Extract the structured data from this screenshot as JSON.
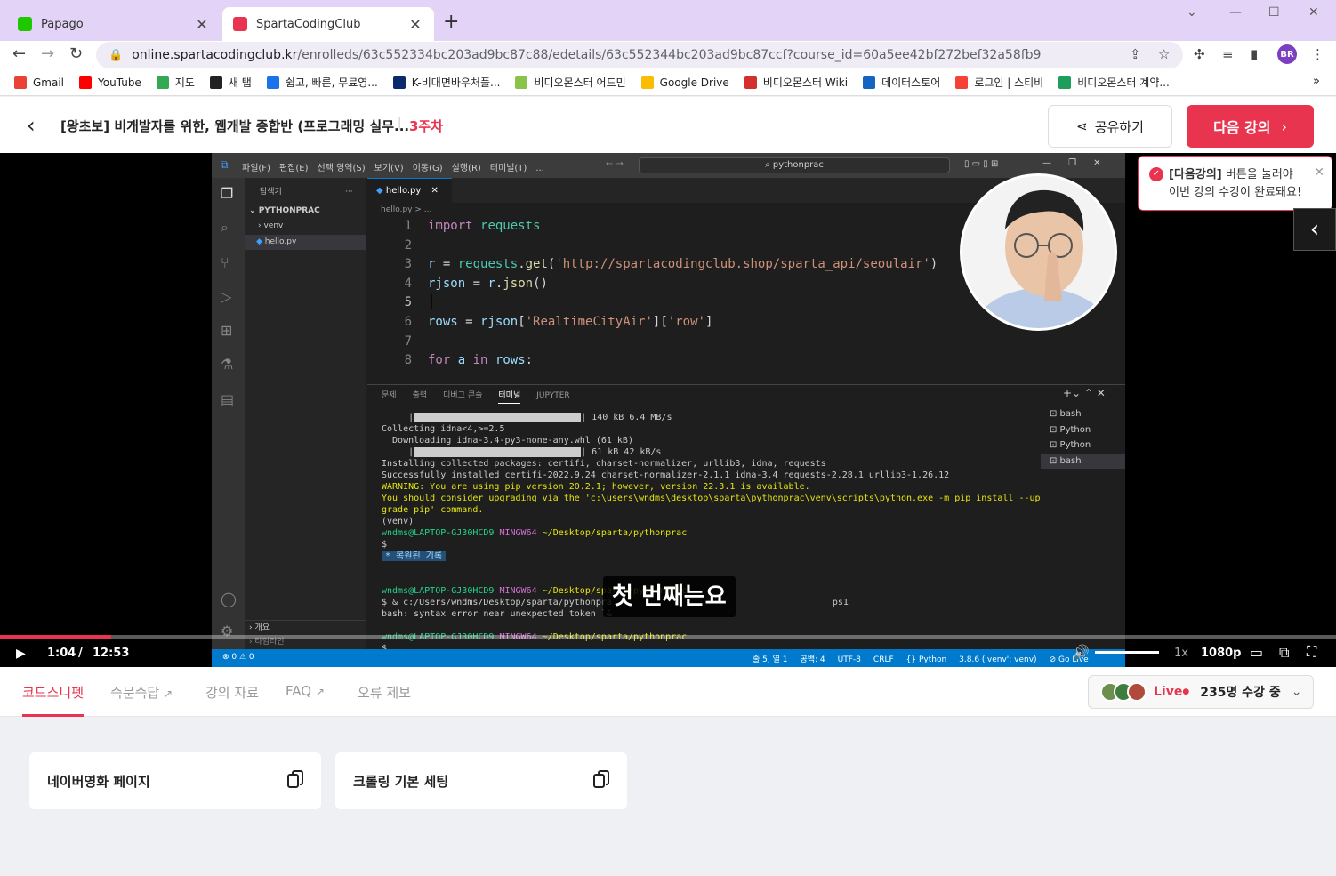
{
  "browser": {
    "tabs": [
      {
        "title": "Papago",
        "active": false
      },
      {
        "title": "SpartaCodingClub",
        "active": true
      }
    ],
    "url_host": "online.spartacodingclub.kr",
    "url_path": "/enrolleds/63c552334bc203ad9bc87c88/edetails/63c552344bc203ad9bc87ccf?course_id=60a5ee42bf272bef32a58fb9",
    "profile_initials": "BR",
    "bookmarks": [
      {
        "label": "Gmail",
        "color": "#ea4335"
      },
      {
        "label": "YouTube",
        "color": "#ff0000"
      },
      {
        "label": "지도",
        "color": "#34a853"
      },
      {
        "label": "새 탭",
        "color": "#222222"
      },
      {
        "label": "쉽고, 빠른, 무료영...",
        "color": "#1a73e8"
      },
      {
        "label": "K-비대면바우처플...",
        "color": "#0b2a6b"
      },
      {
        "label": "비디오몬스터 어드민",
        "color": "#8bc34a"
      },
      {
        "label": "Google Drive",
        "color": "#fbbc04"
      },
      {
        "label": "비디오몬스터 Wiki",
        "color": "#d32f2f"
      },
      {
        "label": "데이터스토어",
        "color": "#1565c0"
      },
      {
        "label": "로그인 | 스티비",
        "color": "#f44336"
      },
      {
        "label": "비디오몬스터 계약...",
        "color": "#1e9e5a"
      }
    ],
    "bookmarks_more": "»"
  },
  "header": {
    "course_title": "[왕초보] 비개발자를 위한, 웹개발 종합반 (프로그래밍 실무...",
    "week": "3주차",
    "share_label": "공유하기",
    "next_label": "다음 강의"
  },
  "tooltip": {
    "bold": "[다음강의]",
    "line1_rest": " 버튼을 눌러야",
    "line2": "이번 강의 수강이 완료돼요!"
  },
  "vscode": {
    "menu": [
      "파일(F)",
      "편집(E)",
      "선택 영역(S)",
      "보기(V)",
      "이동(G)",
      "실행(R)",
      "터미널(T)",
      "..."
    ],
    "search": "pythonprac",
    "explorer_title": "탐색기",
    "folder": "PYTHONPRAC",
    "tree": [
      "venv",
      "hello.py"
    ],
    "outline": [
      "개요",
      "타임라인"
    ],
    "tab_file": "hello.py",
    "breadcrumb": "hello.py > ...",
    "code": [
      {
        "n": "1",
        "t": "import requests"
      },
      {
        "n": "2",
        "t": ""
      },
      {
        "n": "3",
        "t": "r = requests.get('http://spartacodingclub.shop/sparta_api/seoulair')"
      },
      {
        "n": "4",
        "t": "rjson = r.json()"
      },
      {
        "n": "5",
        "t": ""
      },
      {
        "n": "6",
        "t": "rows = rjson['RealtimeCityAir']['row']"
      },
      {
        "n": "7",
        "t": ""
      },
      {
        "n": "8",
        "t": "for a in rows:"
      }
    ],
    "panel_tabs": [
      "문제",
      "출력",
      "디버그 콘솔",
      "터미널",
      "JUPYTER"
    ],
    "terminal": [
      "140 kB 6.4 MB/s",
      "Collecting idna<4,>=2.5",
      "  Downloading idna-3.4-py3-none-any.whl (61 kB)",
      "61 kB 42 kB/s",
      "Installing collected packages: certifi, charset-normalizer, urllib3, idna, requests",
      "Successfully installed certifi-2022.9.24 charset-normalizer-2.1.1 idna-3.4 requests-2.28.1 urllib3-1.26.12",
      "WARNING: You are using pip version 20.2.1; however, version 22.3.1 is available.",
      "You should consider upgrading via the 'c:\\users\\wndms\\desktop\\sparta\\pythonprac\\venv\\scripts\\python.exe -m pip install --up",
      "grade pip' command.",
      "(venv)",
      "$",
      "* 복원된 기록",
      "$ & c:/Users/wndms/Desktop/sparta/pythonpra",
      "bash: syntax error near unexpected token `&",
      "$"
    ],
    "prompt_user": "wndms@LAPTOP-GJ30HCD9",
    "prompt_env": "MINGW64",
    "prompt_path": "~/Desktop/sparta/pythonprac",
    "term_suffix": "ps1",
    "terminal_list": [
      "bash",
      "Python",
      "Python",
      "bash"
    ],
    "status_left": "⊗ 0 ⚠ 0",
    "status_right": [
      "줄 5, 열 1",
      "공백: 4",
      "UTF-8",
      "CRLF",
      "{} Python",
      "3.8.6 ('venv': venv)",
      "⊘ Go Live"
    ]
  },
  "subtitle": "첫 번째는요",
  "player": {
    "current_time": "1:04",
    "separator": "/",
    "duration": "12:53",
    "progress_fraction": 0.083,
    "speed": "1x",
    "quality": "1080p"
  },
  "lesson_tabs": [
    {
      "label": "코드스니펫",
      "active": true,
      "external": false
    },
    {
      "label": "즉문즉답",
      "active": false,
      "external": true
    },
    {
      "label": "강의 자료",
      "active": false,
      "external": false
    },
    {
      "label": "FAQ",
      "active": false,
      "external": true
    },
    {
      "label": "오류 제보",
      "active": false,
      "external": false
    }
  ],
  "live": {
    "label": "Live",
    "count_text": "235명 수강 중"
  },
  "snippets": [
    {
      "title": "네이버영화 페이지"
    },
    {
      "title": "크롤링 기본 세팅"
    }
  ],
  "colors": {
    "accent": "#e8344e",
    "tab_strip": "#e3d4f7",
    "vscode_status": "#007acc"
  }
}
